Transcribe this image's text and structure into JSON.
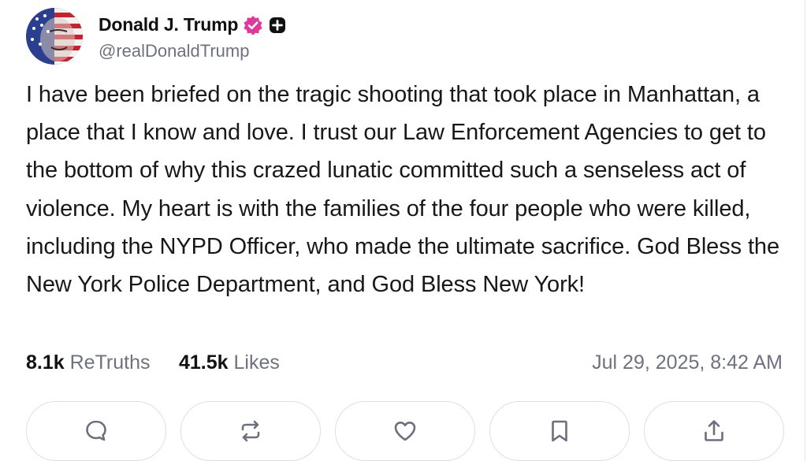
{
  "author": {
    "name": "Donald J. Trump",
    "handle": "@realDonaldTrump",
    "verified_icon": "verified-badge-icon",
    "plus_icon": "plus-badge-icon",
    "verified_color": "#e0389d"
  },
  "post": {
    "text": "I have been briefed on the tragic shooting that took place in Manhattan, a place that I know and love. I trust our Law Enforcement Agencies to get to the bottom of why this crazed lunatic committed such a senseless act of violence. My heart is with the families of the four people who were killed, including the NYPD Officer, who made the ultimate sacrifice. God Bless the New York Police Department, and God Bless New York!"
  },
  "stats": {
    "retruths_count": "8.1k",
    "retruths_label": "ReTruths",
    "likes_count": "41.5k",
    "likes_label": "Likes",
    "timestamp": "Jul 29, 2025, 8:42 AM"
  },
  "actions": [
    {
      "icon": "reply-icon"
    },
    {
      "icon": "retruth-icon"
    },
    {
      "icon": "like-icon"
    },
    {
      "icon": "bookmark-icon"
    },
    {
      "icon": "share-icon"
    }
  ],
  "colors": {
    "text": "#181818",
    "muted": "#6f7180",
    "border": "#dedfe4",
    "icon": "#6b6f7f"
  }
}
